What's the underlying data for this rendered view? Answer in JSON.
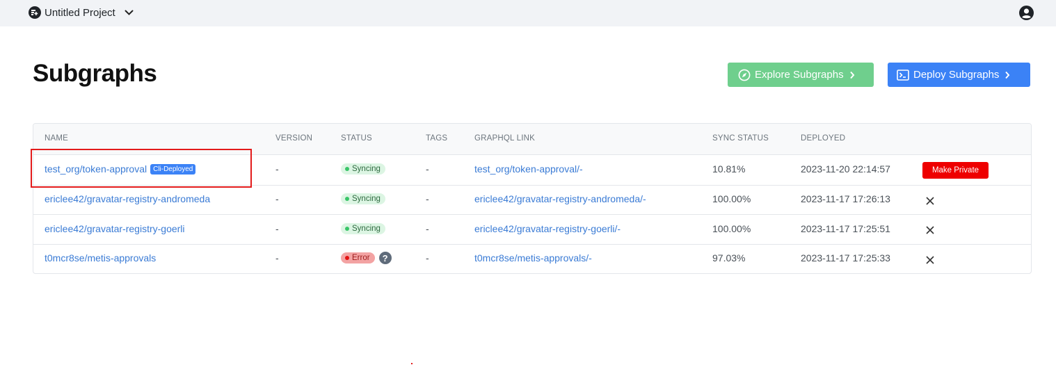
{
  "topbar": {
    "project_name": "Untitled Project",
    "project_icon": "project-logo-icon",
    "dropdown_icon": "chevron-down-icon",
    "user_icon": "user-circle-icon"
  },
  "page": {
    "title": "Subgraphs"
  },
  "actions": {
    "explore_label": "Explore Subgraphs",
    "explore_icon": "compass-icon",
    "explore_color": "#6fcf8d",
    "deploy_label": "Deploy Subgraphs",
    "deploy_icon": "terminal-icon",
    "deploy_color": "#3b82f6"
  },
  "table": {
    "headers": [
      "NAME",
      "VERSION",
      "STATUS",
      "TAGS",
      "GRAPHQL LINK",
      "SYNC STATUS",
      "DEPLOYED"
    ],
    "rows": [
      {
        "name": "test_org/token-approval",
        "name_tag": "Cli-Deployed",
        "version": "-",
        "status": "Syncing",
        "tags": "-",
        "graphql_link": "test_org/token-approval/-",
        "sync_status": "10.81%",
        "deployed": "2023-11-20 22:14:57",
        "action_label": "Make Private"
      },
      {
        "name": "ericlee42/gravatar-registry-andromeda",
        "version": "-",
        "status": "Syncing",
        "tags": "-",
        "graphql_link": "ericlee42/gravatar-registry-andromeda/-",
        "sync_status": "100.00%",
        "deployed": "2023-11-17 17:26:13",
        "action_icon": "close-icon"
      },
      {
        "name": "ericlee42/gravatar-registry-goerli",
        "version": "-",
        "status": "Syncing",
        "tags": "-",
        "graphql_link": "ericlee42/gravatar-registry-goerli/-",
        "sync_status": "100.00%",
        "deployed": "2023-11-17 17:25:51",
        "action_icon": "close-icon"
      },
      {
        "name": "t0mcr8se/metis-approvals",
        "version": "-",
        "status": "Error",
        "status_help": "?",
        "tags": "-",
        "graphql_link": "t0mcr8se/metis-approvals/-",
        "sync_status": "97.03%",
        "deployed": "2023-11-17 17:25:33",
        "action_icon": "close-icon"
      }
    ]
  },
  "colors": {
    "link": "#3a7bd5",
    "syncing_badge": "#dcf5e3",
    "error_badge": "#f3a3a3",
    "make_private": "#ee0000",
    "highlight": "#e31b1b"
  }
}
